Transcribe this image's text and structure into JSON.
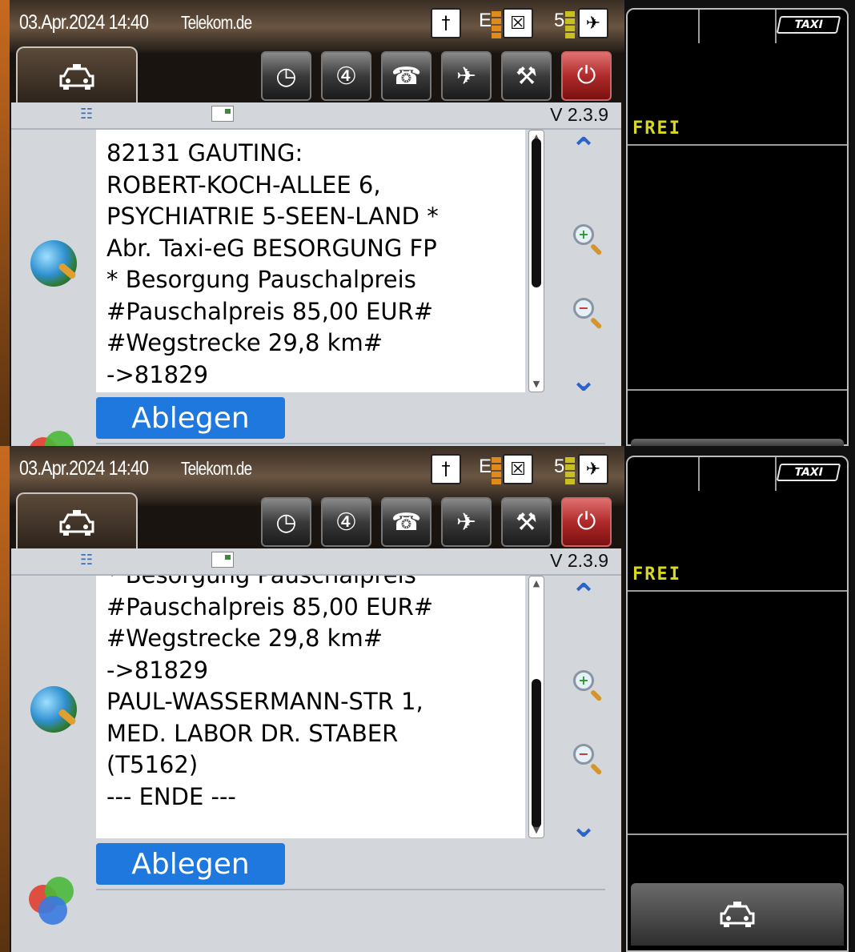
{
  "status": {
    "datetime": "03.Apr.2024 14:40",
    "carrier": "Telekom.de",
    "network_label": "E",
    "sat_count": "5"
  },
  "toolbar": {
    "icons": [
      "timer-icon",
      "fourwinds-icon",
      "phone-icon",
      "satellite-icon",
      "tools-icon",
      "power-icon"
    ]
  },
  "version": "V 2.3.9",
  "message_top": {
    "lines": [
      "82131 GAUTING:",
      "ROBERT-KOCH-ALLEE 6,",
      "PSYCHIATRIE 5-SEEN-LAND *",
      "Abr. Taxi-eG BESORGUNG FP",
      "* Besorgung Pauschalpreis",
      "#Pauschalpreis 85,00 EUR#",
      "#Wegstrecke 29,8 km#",
      "->81829"
    ]
  },
  "message_bottom": {
    "lines": [
      "* Besorgung Pauschalpreis",
      "#Pauschalpreis 85,00 EUR#",
      "#Wegstrecke 29,8 km#",
      "->81829",
      "PAUL-WASSERMANN-STR 1,",
      "MED. LABOR DR. STABER",
      "(T5162)",
      "--- ENDE ---"
    ]
  },
  "buttons": {
    "ablegen": "Ablegen"
  },
  "meter": {
    "badge": "TAXI",
    "state": "FREI"
  },
  "colors": {
    "accent_blue": "#1e78de",
    "frei_yellow": "#d8d820",
    "alarm_red": "#b02a2a"
  }
}
